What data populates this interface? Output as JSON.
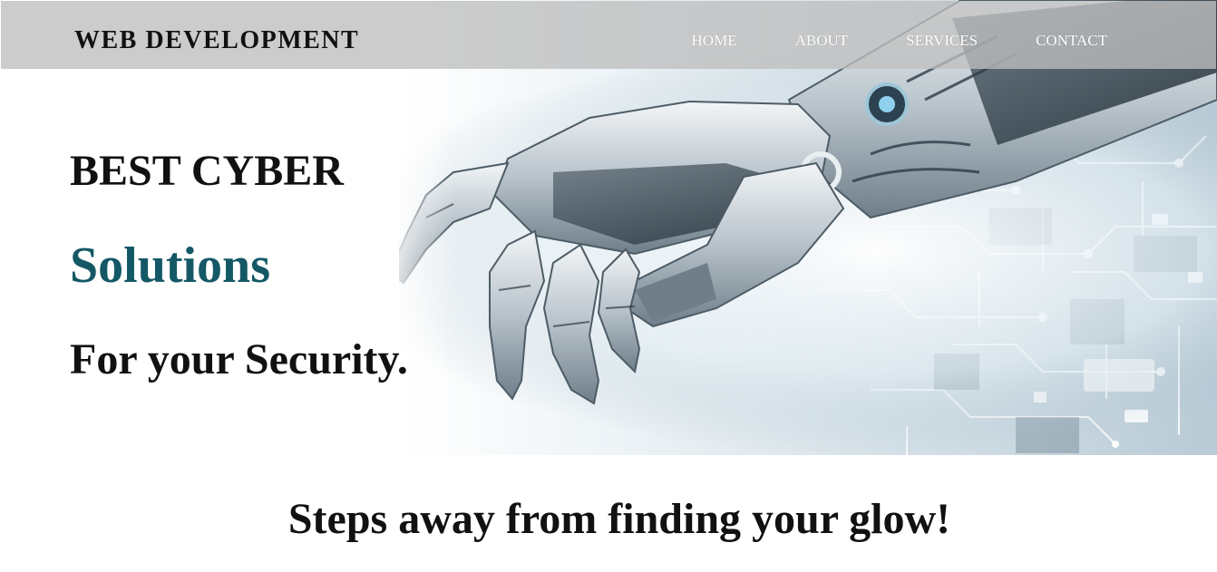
{
  "navbar": {
    "brand": "WEB DEVELOPMENT",
    "links": [
      {
        "label": "HOME"
      },
      {
        "label": "ABOUT"
      },
      {
        "label": "SERVICES"
      },
      {
        "label": "CONTACT"
      }
    ]
  },
  "hero": {
    "line1": "BEST CYBER",
    "line2": "Solutions",
    "line3": "For your Security.",
    "image": "robotic-hand-circuit-board-image",
    "accent_color": "#145866"
  },
  "tagline": "Steps away from finding your glow!"
}
